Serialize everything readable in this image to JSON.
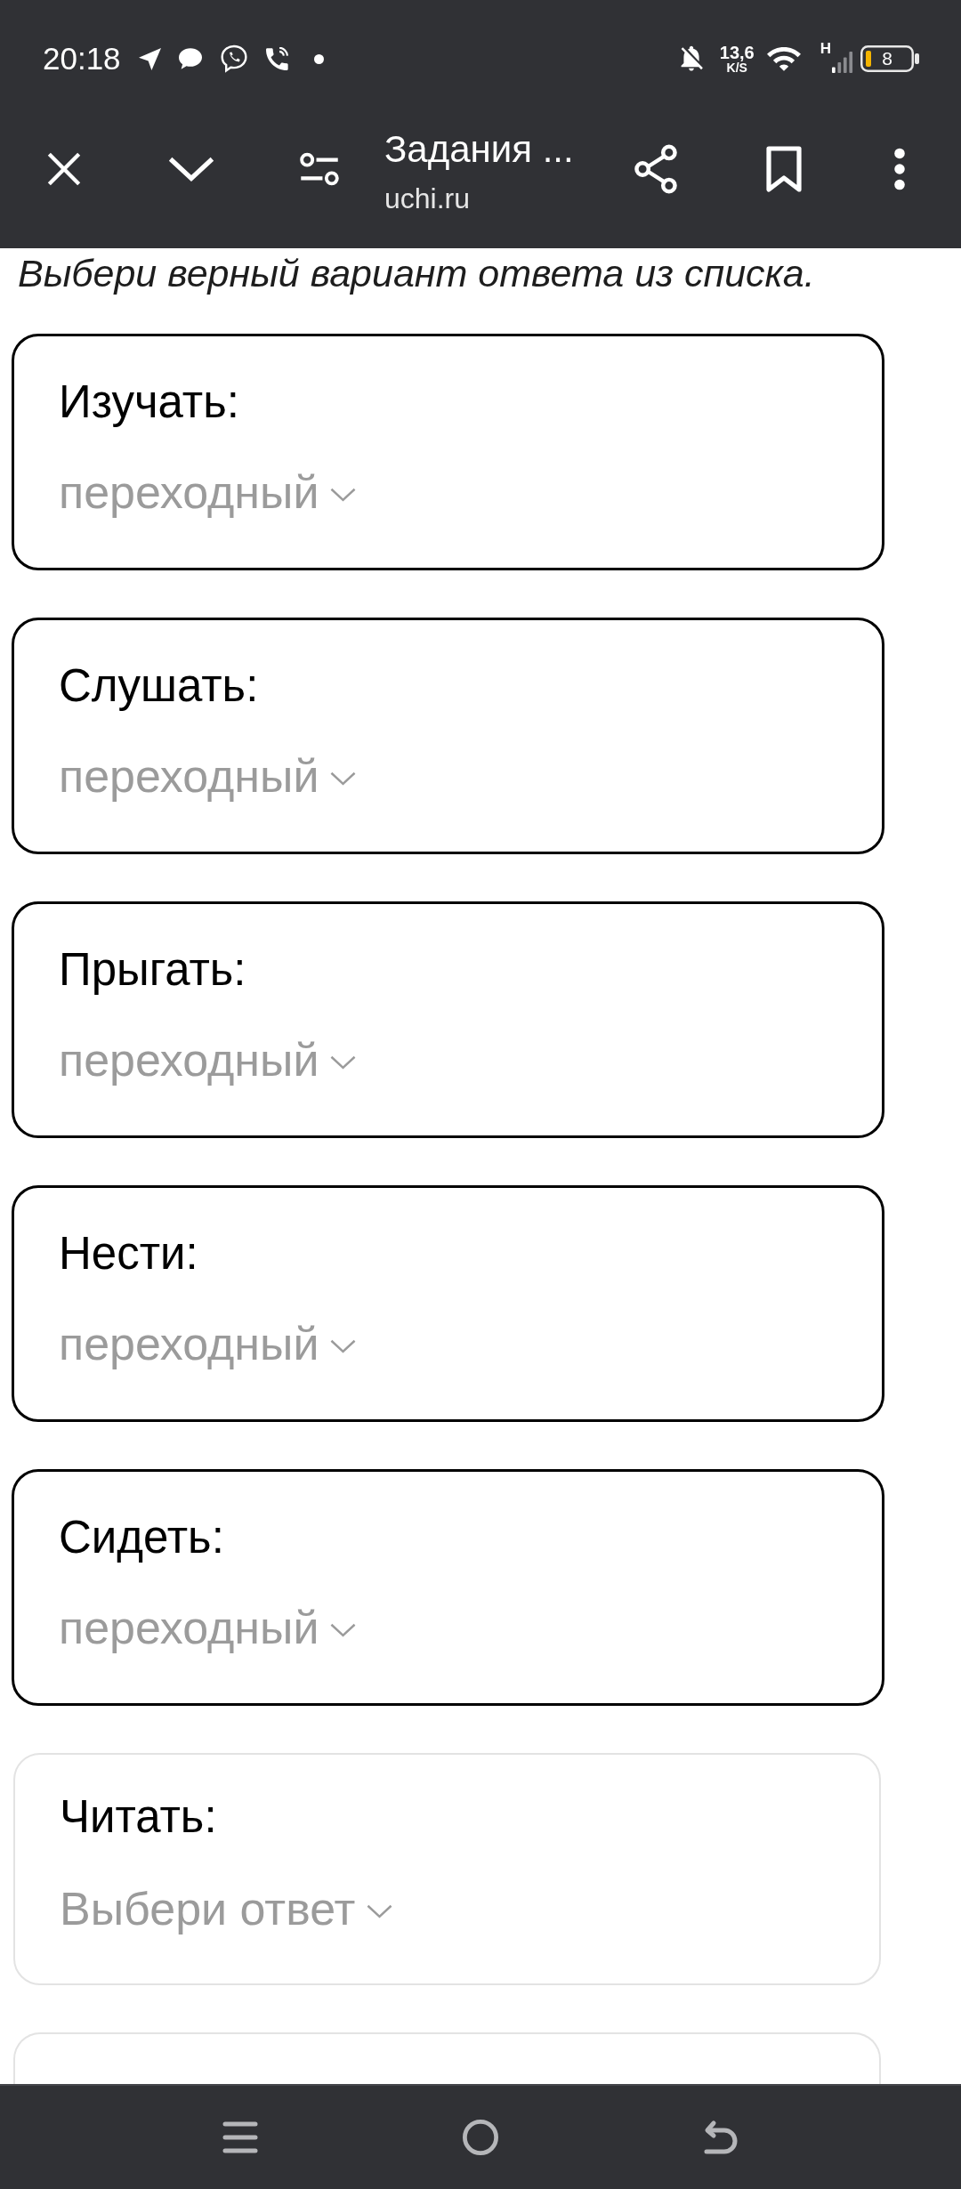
{
  "status_bar": {
    "time": "20:18",
    "speed_value": "13,6",
    "speed_unit": "K/S",
    "network_type": "H",
    "battery": "8"
  },
  "toolbar": {
    "title": "Задания ...",
    "url": "uchi.ru"
  },
  "instruction": "Выбери верный вариант ответа из списка.",
  "questions": [
    {
      "label": "Изучать:",
      "value": "переходный",
      "answered": true
    },
    {
      "label": "Слушать:",
      "value": "переходный",
      "answered": true
    },
    {
      "label": "Прыгать:",
      "value": "переходный",
      "answered": true
    },
    {
      "label": "Нести:",
      "value": "переходный",
      "answered": true
    },
    {
      "label": "Сидеть:",
      "value": "переходный",
      "answered": true
    },
    {
      "label": "Читать:",
      "placeholder": "Выбери ответ",
      "answered": false
    },
    {
      "answered": false
    }
  ]
}
